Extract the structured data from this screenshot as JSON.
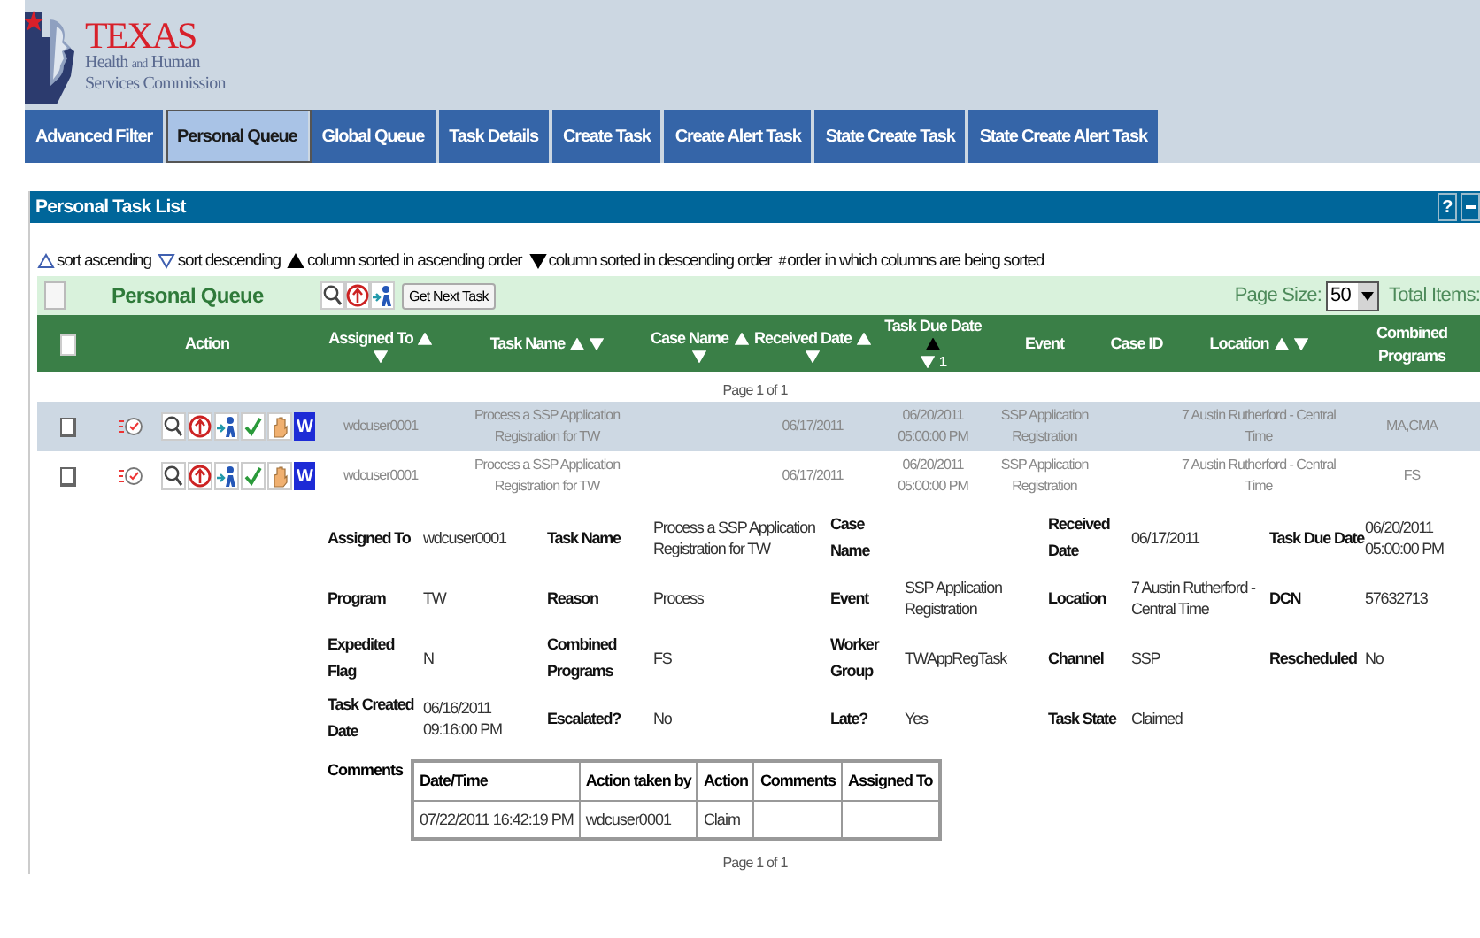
{
  "logo": {
    "title": "TEXAS",
    "line_1_start": "Health",
    "line_1_small": "and",
    "line_1_end": "Human",
    "line_2": "Services Commission"
  },
  "tabs": [
    {
      "label": "Advanced Filter",
      "selected": false
    },
    {
      "label": "Personal Queue",
      "selected": true
    },
    {
      "label": "Global Queue",
      "selected": false
    },
    {
      "label": "Task Details",
      "selected": false
    },
    {
      "label": "Create Task",
      "selected": false
    },
    {
      "label": "Create Alert Task",
      "selected": false
    },
    {
      "label": "State Create Task",
      "selected": false
    },
    {
      "label": "State Create Alert Task",
      "selected": false
    }
  ],
  "panel": {
    "title": "Personal Task List",
    "help": "?"
  },
  "legend": [
    {
      "kind": "outline-up",
      "text": "sort ascending"
    },
    {
      "kind": "outline-down",
      "text": "sort descending"
    },
    {
      "kind": "filled-up",
      "text": "column sorted in ascending order"
    },
    {
      "kind": "filled-down",
      "text": "column sorted in descending order"
    },
    {
      "kind": "mark",
      "symbol": "#",
      "text": "order in which columns are being sorted"
    }
  ],
  "queue_bar": {
    "title": "Personal Queue",
    "next_button": "Get Next Task",
    "page_size_label": "Page Size:",
    "page_size": "50",
    "total_label": "Total Items:"
  },
  "columns": [
    {
      "kind": "checkbox",
      "checked": false
    },
    {
      "label": "Action",
      "kind": "plain"
    },
    {
      "label": "Assigned To",
      "kind": "sort-stacked"
    },
    {
      "label": "Task Name",
      "kind": "sort-inline"
    },
    {
      "label": "Case Name",
      "kind": "sort-stacked"
    },
    {
      "label": "Received Date",
      "kind": "sort-stacked"
    },
    {
      "label": "Task Due Date",
      "kind": "sort-stacked",
      "sorted_ascending": true,
      "order": "1"
    },
    {
      "label": "Event",
      "kind": "plain"
    },
    {
      "label": "Case ID",
      "kind": "plain"
    },
    {
      "label": "Location",
      "kind": "sort-inline"
    },
    {
      "label": "Combined Programs",
      "kind": "plain"
    }
  ],
  "page_info_top": "Page 1 of 1",
  "rows": [
    {
      "selected": true,
      "checked": false,
      "badge": "W",
      "assigned_to": "wdcuser0001",
      "task_name": "Process a SSP Application Registration for TW",
      "received_date": "06/17/2011",
      "task_due_date": "06/20/2011 05:00:00 PM",
      "event": "SSP Application Registration",
      "location": "7 Austin Rutherford - Central Time",
      "combined_programs": "MA,CMA"
    },
    {
      "selected": false,
      "checked": false,
      "badge": "W",
      "assigned_to": "wdcuser0001",
      "task_name": "Process a SSP Application Registration for TW",
      "received_date": "06/17/2011",
      "task_due_date": "06/20/2011 05:00:00 PM",
      "event": "SSP Application Registration",
      "location": "7 Austin Rutherford - Central Time",
      "combined_programs": "FS"
    }
  ],
  "details": [
    [
      {
        "label": "Assigned To",
        "value": "wdcuser0001"
      },
      {
        "label": "Task Name",
        "value": "Process a SSP Application Registration for TW"
      },
      {
        "label": "Case Name"
      },
      {
        "label": "Received Date",
        "value": "06/17/2011"
      },
      {
        "label": "Task Due Date",
        "value": "06/20/2011 05:00:00 PM"
      }
    ],
    [
      {
        "label": "Program",
        "value": "TW"
      },
      {
        "label": "Reason",
        "value": "Process"
      },
      {
        "label": "Event",
        "value": "SSP Application Registration"
      },
      {
        "label": "Location",
        "value": "7 Austin Rutherford - Central Time"
      },
      {
        "label": "DCN",
        "value": "57632713"
      }
    ],
    [
      {
        "label": "Expedited Flag",
        "value": "N"
      },
      {
        "label": "Combined Programs",
        "value": "FS"
      },
      {
        "label": "Worker Group",
        "value": "TWAppRegTask"
      },
      {
        "label": "Channel",
        "value": "SSP"
      },
      {
        "label": "Rescheduled",
        "value": "No"
      }
    ],
    [
      {
        "label": "Task Created Date",
        "value": "06/16/2011 09:16:00 PM"
      },
      {
        "label": "Escalated?",
        "value": "No"
      },
      {
        "label": "Late?",
        "value": "Yes"
      },
      {
        "label": "Task State",
        "value": "Claimed"
      }
    ]
  ],
  "comments": {
    "label": "Comments",
    "columns": [
      "Date/Time",
      "Action taken by",
      "Action",
      "Comments",
      "Assigned To"
    ],
    "rows": [
      {
        "date_time": "07/22/2011 16:42:19 PM",
        "action_taken_by": "wdcuser0001",
        "action": "Claim"
      }
    ]
  },
  "page_info_bottom": "Page 1 of 1"
}
